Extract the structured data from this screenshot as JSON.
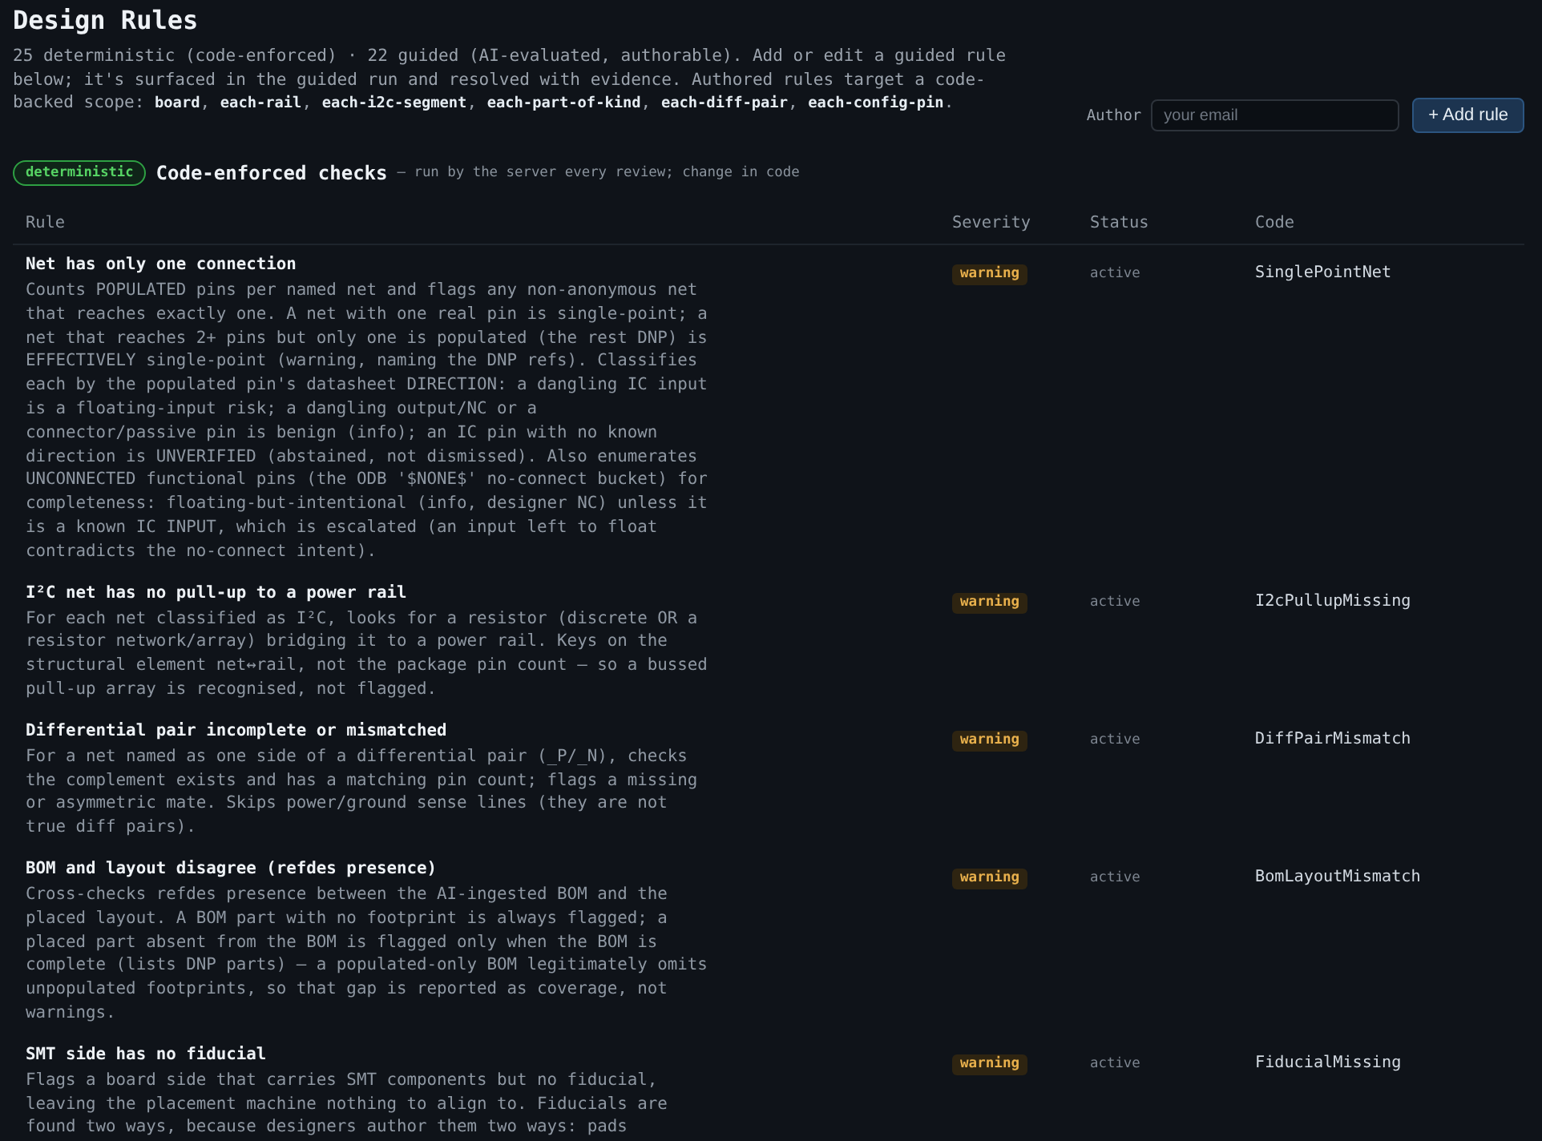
{
  "header": {
    "title": "Design Rules",
    "summary": "25 deterministic (code-enforced) · 22 guided (AI-evaluated, authorable). Add or edit a guided rule below; it's surfaced in the guided run and resolved with evidence. Authored rules target a code-backed scope: **board**, **each-rail**, **each-i2c-segment**, **each-part-of-kind**, **each-diff-pair**, **each-config-pin**."
  },
  "author": {
    "label": "Author",
    "placeholder": "your email",
    "button": "+ Add rule"
  },
  "section": {
    "badge": "deterministic",
    "title": "Code-enforced checks",
    "note": "— run by the server every review; change in code"
  },
  "table": {
    "columns": [
      "Rule",
      "Severity",
      "Status",
      "Code"
    ],
    "rows": [
      {
        "title": "Net has only one connection",
        "description": "Counts POPULATED pins per named net and flags any non-anonymous net that reaches exactly one. A net with one real pin is single-point; a net that reaches 2+ pins but only one is populated (the rest DNP) is EFFECTIVELY single-point (warning, naming the DNP refs). Classifies each by the populated pin's datasheet DIRECTION: a dangling IC input is a floating-input risk; a dangling output/NC or a connector/passive pin is benign (info); an IC pin with no known direction is UNVERIFIED (abstained, not dismissed). Also enumerates UNCONNECTED functional pins (the ODB '$NONE$' no-connect bucket) for completeness: floating-but-intentional (info, designer NC) unless it is a known IC INPUT, which is escalated (an input left to float contradicts the no-connect intent).",
        "severity": "warning",
        "status": "active",
        "code": "SinglePointNet"
      },
      {
        "title": "I²C net has no pull-up to a power rail",
        "description": "For each net classified as I²C, looks for a resistor (discrete OR a resistor network/array) bridging it to a power rail. Keys on the structural element net↔rail, not the package pin count — so a bussed pull-up array is recognised, not flagged.",
        "severity": "warning",
        "status": "active",
        "code": "I2cPullupMissing"
      },
      {
        "title": "Differential pair incomplete or mismatched",
        "description": "For a net named as one side of a differential pair (_P/_N), checks the complement exists and has a matching pin count; flags a missing or asymmetric mate. Skips power/ground sense lines (they are not true diff pairs).",
        "severity": "warning",
        "status": "active",
        "code": "DiffPairMismatch"
      },
      {
        "title": "BOM and layout disagree (refdes presence)",
        "description": "Cross-checks refdes presence between the AI-ingested BOM and the placed layout. A BOM part with no footprint is always flagged; a placed part absent from the BOM is flagged only when the BOM is complete (lists DNP parts) — a populated-only BOM legitimately omits unpopulated footprints, so that gap is reported as coverage, not warnings.",
        "severity": "warning",
        "status": "active",
        "code": "BomLayoutMismatch"
      },
      {
        "title": "SMT side has no fiducial",
        "description": "Flags a board side that carries SMT components but no fiducial, leaving the placement machine nothing to align to. Fiducials are found two ways, because designers author them two ways: pads",
        "severity": "warning",
        "status": "active",
        "code": "FiducialMissing"
      }
    ]
  }
}
